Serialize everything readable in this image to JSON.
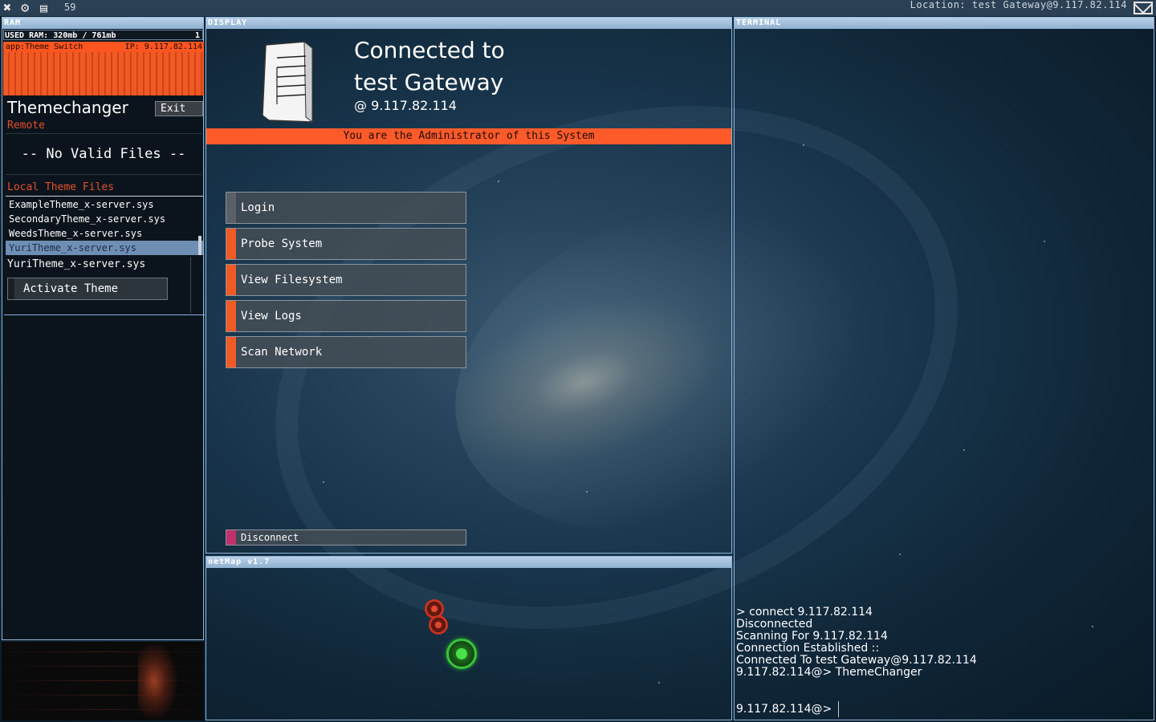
{
  "topbar": {
    "fps": "59",
    "location": "Location: test Gateway@9.117.82.114"
  },
  "ram": {
    "title": "RAM",
    "used_label": "USED RAM: 320mb / 761mb",
    "count": "1"
  },
  "app": {
    "name": "app:Theme Switch",
    "ip": "IP: 9.117.82.114",
    "title": "Themechanger",
    "exit_label": "Exit",
    "remote_label": "Remote",
    "no_files_label": "-- No Valid Files --",
    "local_label": "Local Theme Files",
    "files": [
      "ExampleTheme_x-server.sys",
      "SecondaryTheme_x-server.sys",
      "WeedsTheme_x-server.sys",
      "YuriTheme_x-server.sys"
    ],
    "selected_file": "YuriTheme_x-server.sys",
    "activate_label": "Activate Theme"
  },
  "display": {
    "title": "DISPLAY",
    "connected_to": "Connected to",
    "host_name": "test Gateway",
    "host_ip": "@  9.117.82.114",
    "admin_notice": "You are the Administrator of this System",
    "buttons": {
      "login": "Login",
      "probe": "Probe System",
      "filesystem": "View Filesystem",
      "logs": "View Logs",
      "scan": "Scan Network"
    },
    "disconnect_label": "Disconnect"
  },
  "netmap": {
    "title": "netMap v1.7"
  },
  "terminal": {
    "title": "TERMINAL",
    "lines": [
      "> connect 9.117.82.114",
      "Disconnected",
      "Scanning For 9.117.82.114",
      "Connection Established ::",
      "Connected To test Gateway@9.117.82.114",
      "9.117.82.114@> ThemeChanger"
    ],
    "prompt": "9.117.82.114@>"
  },
  "colors": {
    "accent": "#ff5a2a",
    "panel_border": "#8fb4d6",
    "node_red": "#c8321e",
    "node_green": "#3ac43a"
  }
}
